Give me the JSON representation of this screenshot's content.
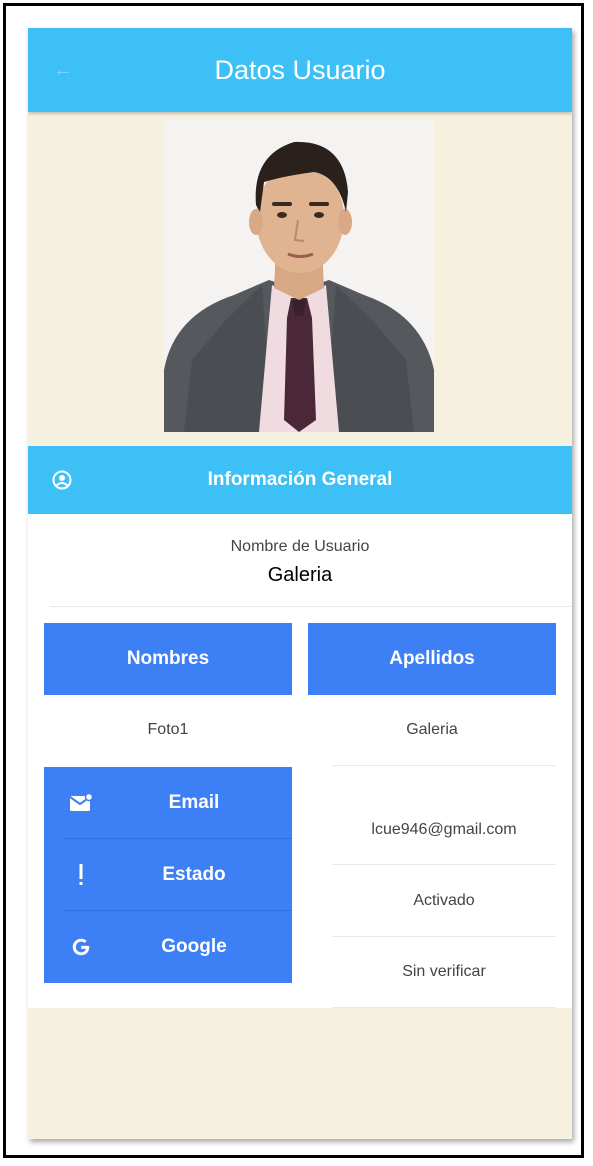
{
  "app": {
    "title": "Datos Usuario",
    "back_icon": "back-arrow-icon"
  },
  "profile": {
    "photo": "user-portrait-photo"
  },
  "section": {
    "title": "Información General",
    "icon": "account-circle-icon"
  },
  "user": {
    "username_label": "Nombre de Usuario",
    "username_value": "Galeria"
  },
  "name_table": {
    "first_header": "Nombres",
    "last_header": "Apellidos",
    "first_value": "Foto1",
    "last_value": "Galeria"
  },
  "details": [
    {
      "label": "Email",
      "icon": "email-icon",
      "value": "lcue946@gmail.com"
    },
    {
      "label": "Estado",
      "icon": "exclamation-icon",
      "value": "Activado"
    },
    {
      "label": "Google",
      "icon": "google-icon",
      "value": "Sin verificar"
    }
  ],
  "colors": {
    "appbar": "#3cc0f5",
    "button": "#3d7ff5",
    "background": "#f6f0de"
  }
}
